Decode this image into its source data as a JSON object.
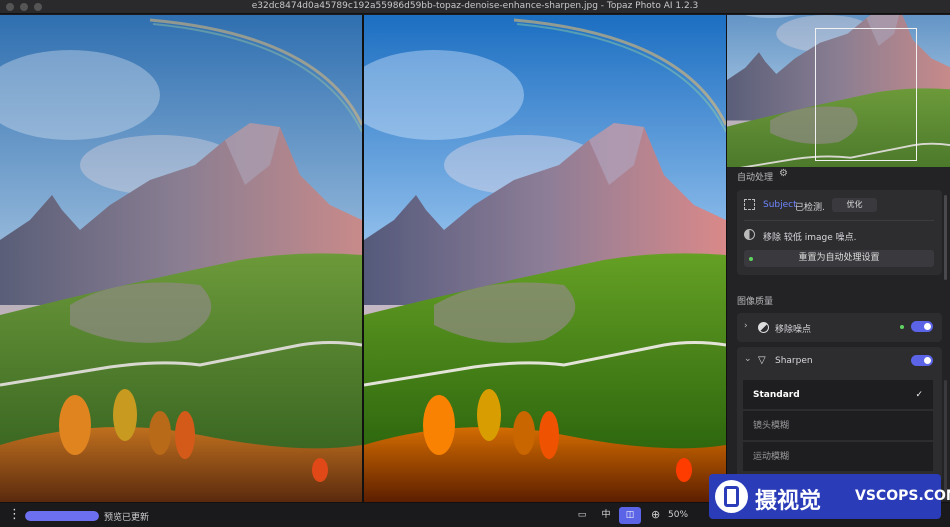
{
  "window": {
    "title": "e32dc8474d0a45789c192a55986d59bb-topaz-denoise-enhance-sharpen.jpg - Topaz Photo AI 1.2.3"
  },
  "panel": {
    "auto": {
      "section_label": "自动处理",
      "subject_word": "Subject",
      "subject_suffix": "已检测.",
      "optimize_button": "优化",
      "noise_note": "移除 较低 image 噪点.",
      "reset_button": "重置为自动处理设置"
    },
    "quality": {
      "section_label": "图像质量",
      "denoise": {
        "label": "移除噪点",
        "enabled": true
      },
      "sharpen": {
        "label": "Sharpen",
        "enabled": true,
        "options": [
          "Standard",
          "镜头模糊",
          "运动模糊"
        ],
        "selected": "Standard",
        "check": "✓"
      }
    }
  },
  "bottom": {
    "menu_glyph": "⋮",
    "preview_status": "预览已更新",
    "preview_progress": 1.0,
    "view_modes": [
      "▭",
      "中",
      "◫"
    ],
    "active_view_mode": 2,
    "zoom_glyph": "⊕",
    "zoom_level": "50%"
  },
  "watermark": {
    "text_cn": "摄视觉",
    "text_en": "VSCOPS.COM"
  },
  "colors": {
    "accent": "#5b63e6",
    "link": "#6f86ff",
    "status_dot": "#5fd35f"
  }
}
